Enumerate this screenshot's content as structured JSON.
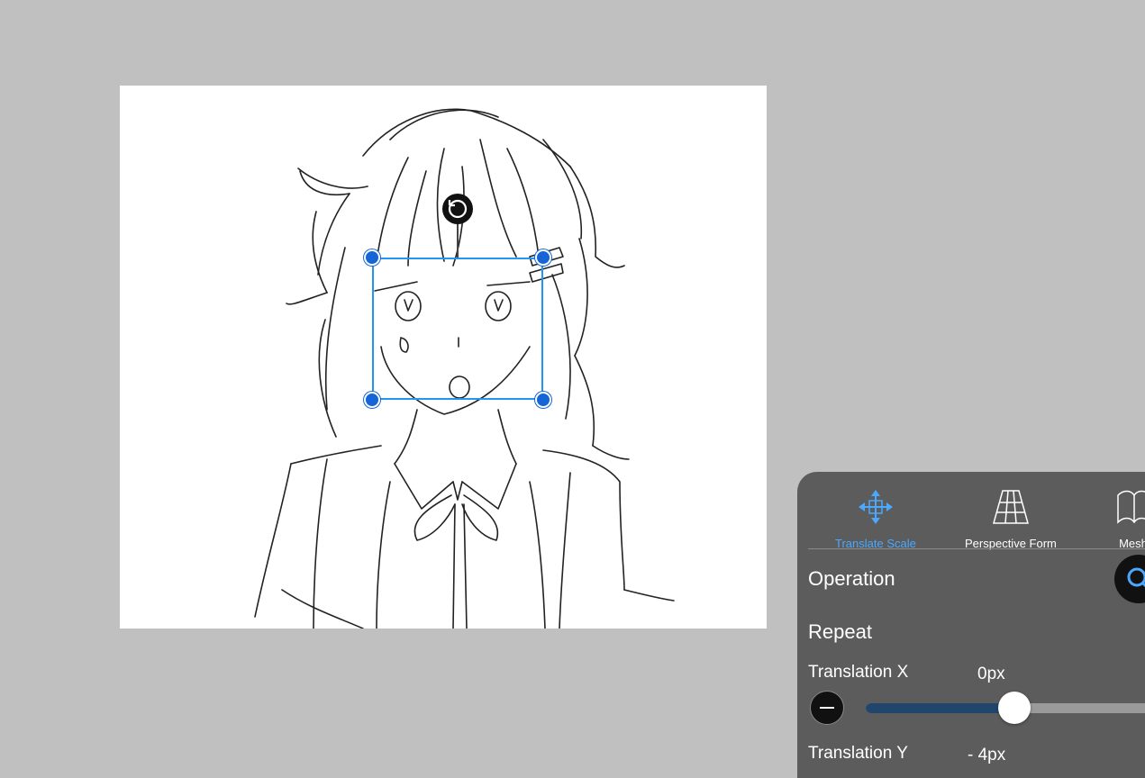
{
  "canvas": {
    "rotate_icon": "rotate-icon"
  },
  "panel": {
    "tools": [
      {
        "label": "Translate Scale",
        "icon": "move-arrows-icon",
        "active": true
      },
      {
        "label": "Perspective Form",
        "icon": "perspective-grid-icon",
        "active": false
      },
      {
        "label": "Mesh",
        "icon": "mesh-icon",
        "active": false
      }
    ],
    "operation_label": "Operation",
    "repeat_label": "Repeat",
    "translation_x": {
      "label": "Translation X",
      "value": "0px",
      "slider_fraction": 0.5
    },
    "translation_y": {
      "label": "Translation Y",
      "value": "- 4px"
    },
    "colors": {
      "accent": "#4aa8ff",
      "panel_bg": "#5c5c5c",
      "slider_fill": "#20466e"
    }
  }
}
